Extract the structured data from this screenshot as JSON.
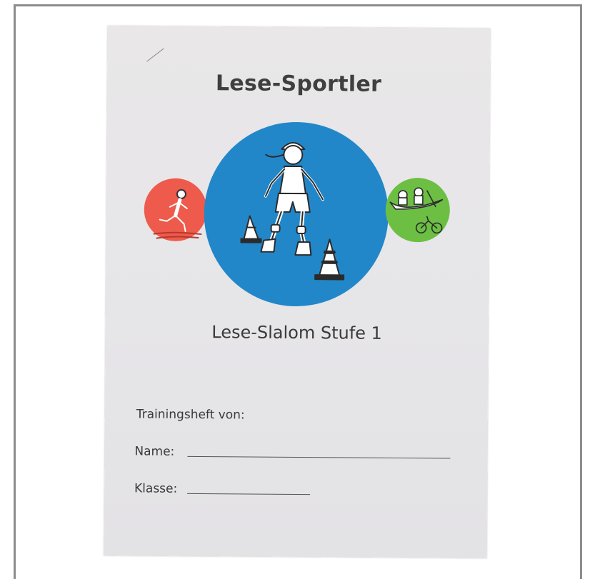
{
  "cover": {
    "title": "Lese-Sportler",
    "subtitle": "Lese-Slalom Stufe 1",
    "owner_label": "Trainingsheft von:",
    "name_label": "Name:",
    "class_label": "Klasse:"
  },
  "colors": {
    "left_circle": "#ee5a4b",
    "center_circle": "#2287c9",
    "right_circle": "#6cbf43"
  },
  "icons": {
    "left": "runner-illustration",
    "center": "inline-skater-slalom-illustration",
    "right": "canoe-and-tandem-bike-illustration"
  }
}
